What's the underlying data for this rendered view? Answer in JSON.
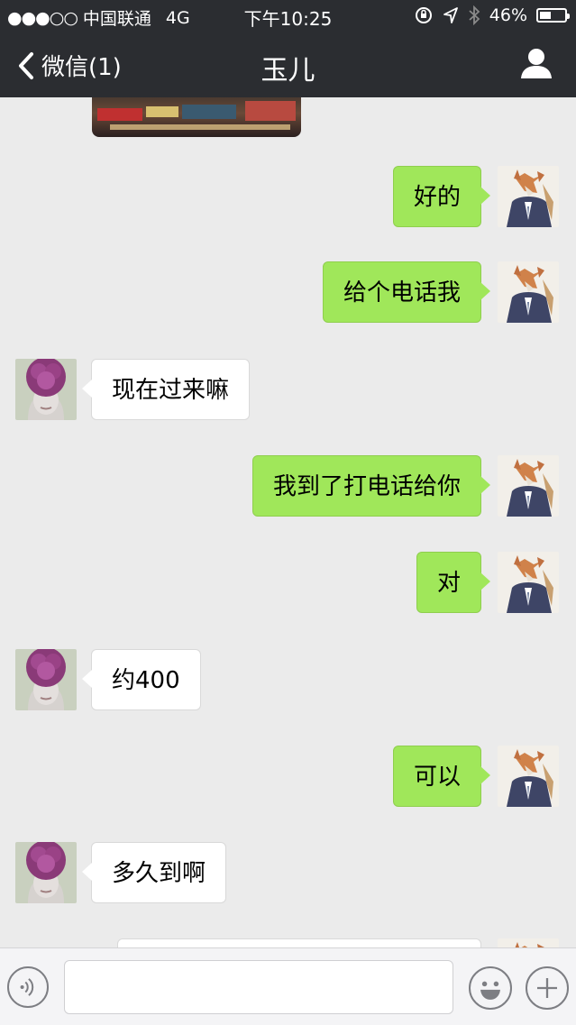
{
  "status_bar": {
    "signal_dots": "●●●○○",
    "carrier": "中国联通",
    "network": "4G",
    "time": "下午10:25",
    "battery_text": "46%",
    "battery_level": 0.46
  },
  "nav": {
    "back_label": "微信(1)",
    "title": "玉儿"
  },
  "messages": [
    {
      "from": "me",
      "text": "好的"
    },
    {
      "from": "me",
      "text": "给个电话我"
    },
    {
      "from": "them",
      "text": "现在过来嘛"
    },
    {
      "from": "me",
      "text": "我到了打电话给你"
    },
    {
      "from": "me",
      "text": "对"
    },
    {
      "from": "them",
      "text": "约400"
    },
    {
      "from": "me",
      "text": "可以"
    },
    {
      "from": "them",
      "text": "多久到啊"
    },
    {
      "from": "me",
      "text": ""
    }
  ],
  "input": {
    "text_value": ""
  },
  "colors": {
    "my_bubble": "#a0e75a",
    "their_bubble": "#ffffff",
    "background": "#ebebeb",
    "header": "#2b2d31"
  },
  "icons": [
    "chevron-left-icon",
    "profile-icon",
    "voice-icon",
    "emoji-icon",
    "plus-icon",
    "lock-rotation-icon",
    "location-arrow-icon",
    "bluetooth-icon",
    "battery-icon"
  ]
}
